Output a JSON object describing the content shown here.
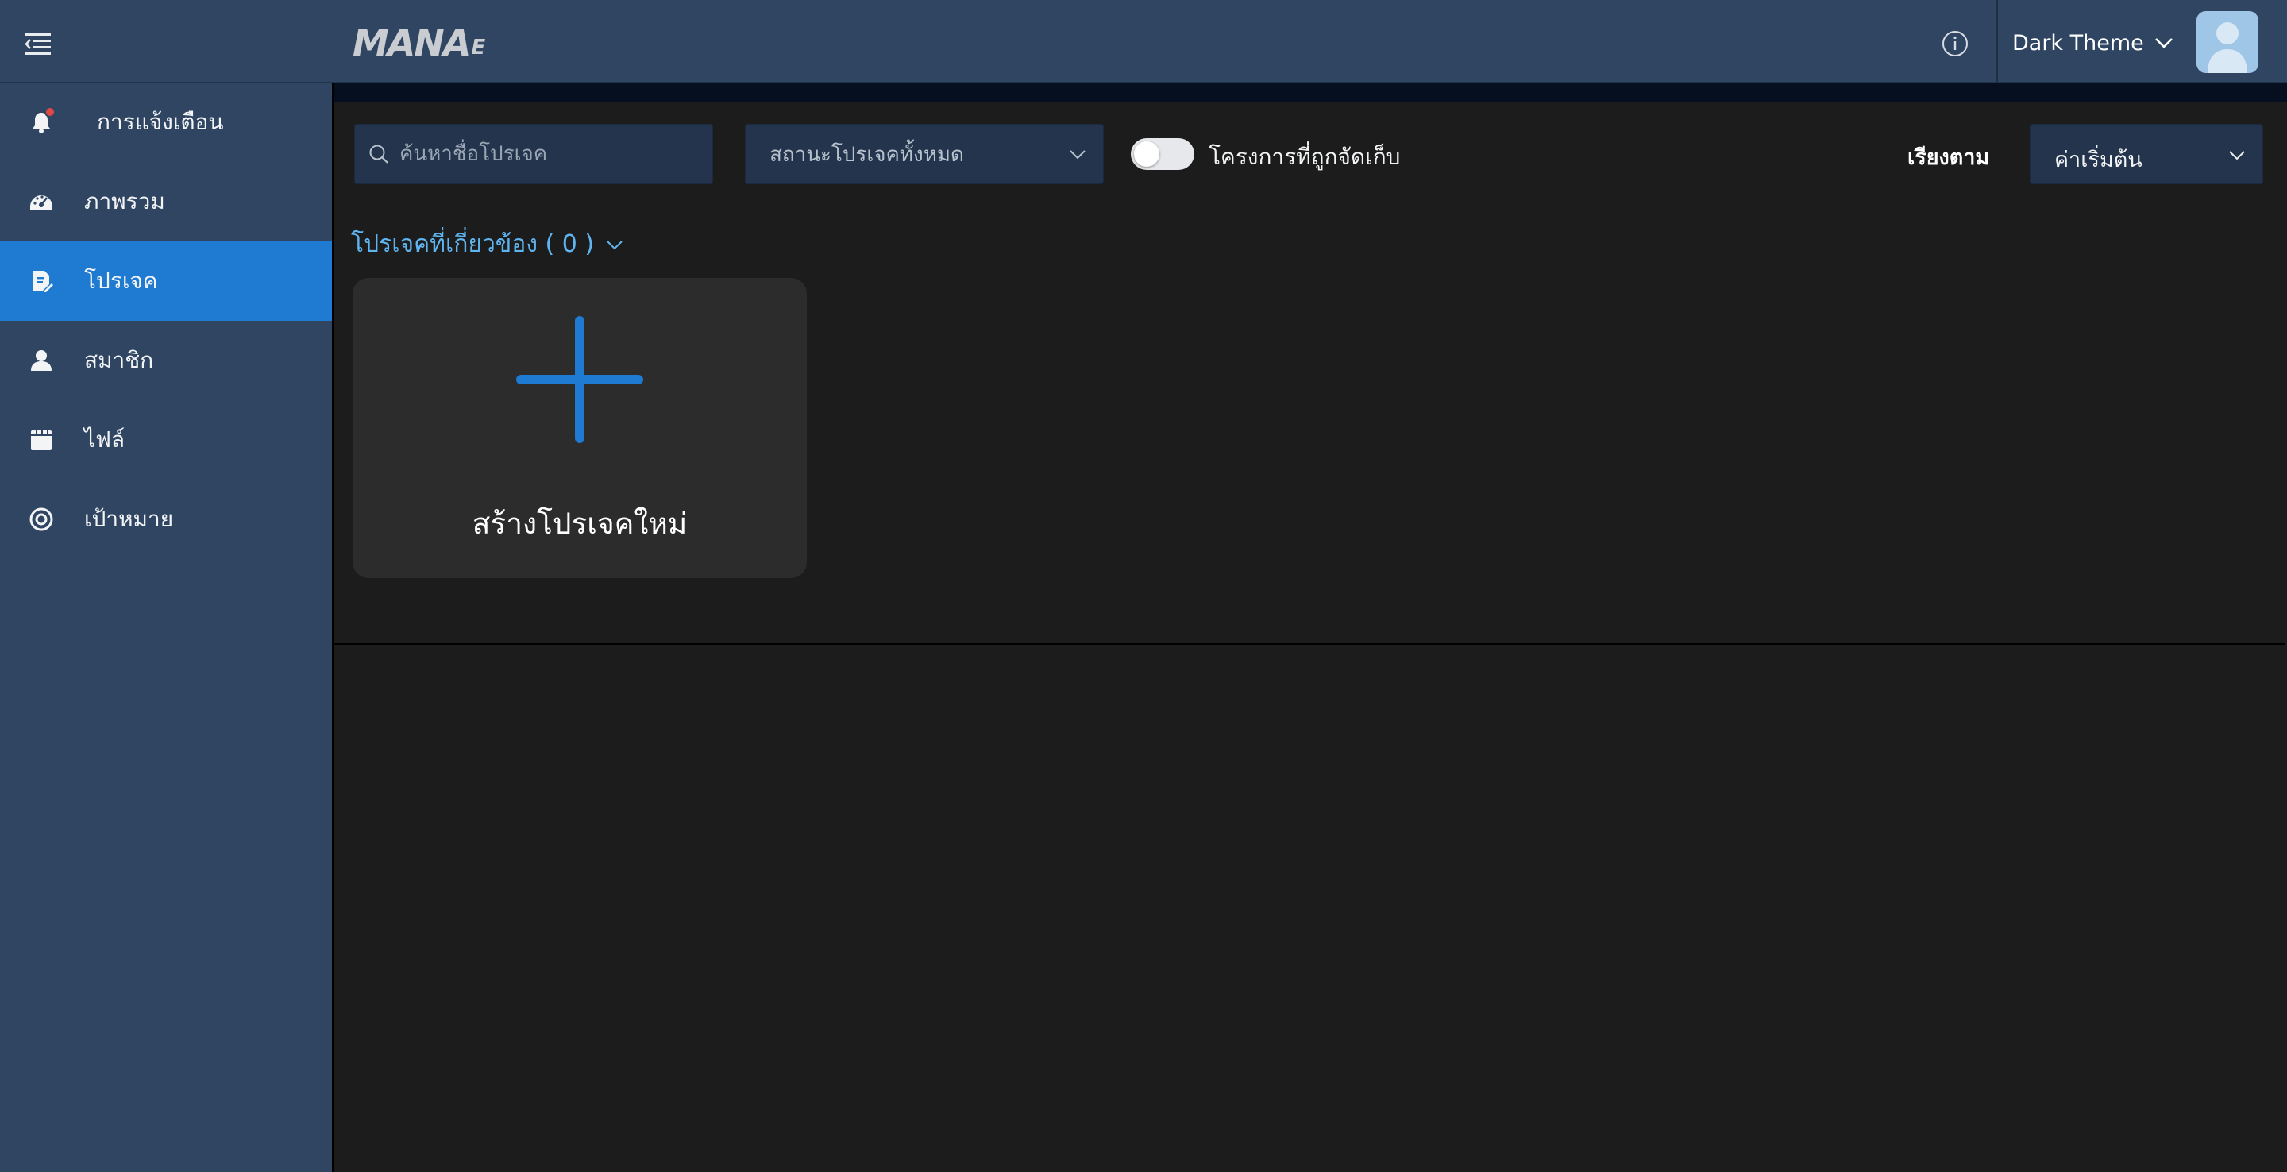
{
  "header": {
    "logo_text": "MANA",
    "logo_suffix": "E",
    "theme_label": "Dark Theme"
  },
  "sidebar": {
    "items": [
      {
        "label": "การแจ้งเตือน",
        "icon": "bell-icon"
      },
      {
        "label": "ภาพรวม",
        "icon": "dashboard-icon"
      },
      {
        "label": "โปรเจค",
        "icon": "project-icon",
        "active": true
      },
      {
        "label": "สมาชิก",
        "icon": "user-icon"
      },
      {
        "label": "ไฟล์",
        "icon": "file-icon"
      },
      {
        "label": "เป้าหมาย",
        "icon": "target-icon"
      }
    ]
  },
  "toolbar": {
    "search_placeholder": "ค้นหาชื่อโปรเจค",
    "status_filter": "สถานะโปรเจคทั้งหมด",
    "archived_toggle_label": "โครงการที่ถูกจัดเก็บ",
    "archived_toggle_on": false,
    "sort_label": "เรียงตาม",
    "sort_value": "ค่าเริ่มต้น"
  },
  "main": {
    "section_title": "โปรเจคที่เกี่ยวข้อง ( 0 )",
    "new_project_label": "สร้างโปรเจคใหม่"
  },
  "colors": {
    "header_bg": "#2f4562",
    "sidebar_bg": "#2f4562",
    "active_item": "#1f7ad2",
    "accent_blue": "#1f7ad2",
    "section_title": "#5fb5f0",
    "main_bg": "#1c1c1c",
    "card_bg": "#2c2c2c",
    "notification_dot": "#e04848"
  }
}
